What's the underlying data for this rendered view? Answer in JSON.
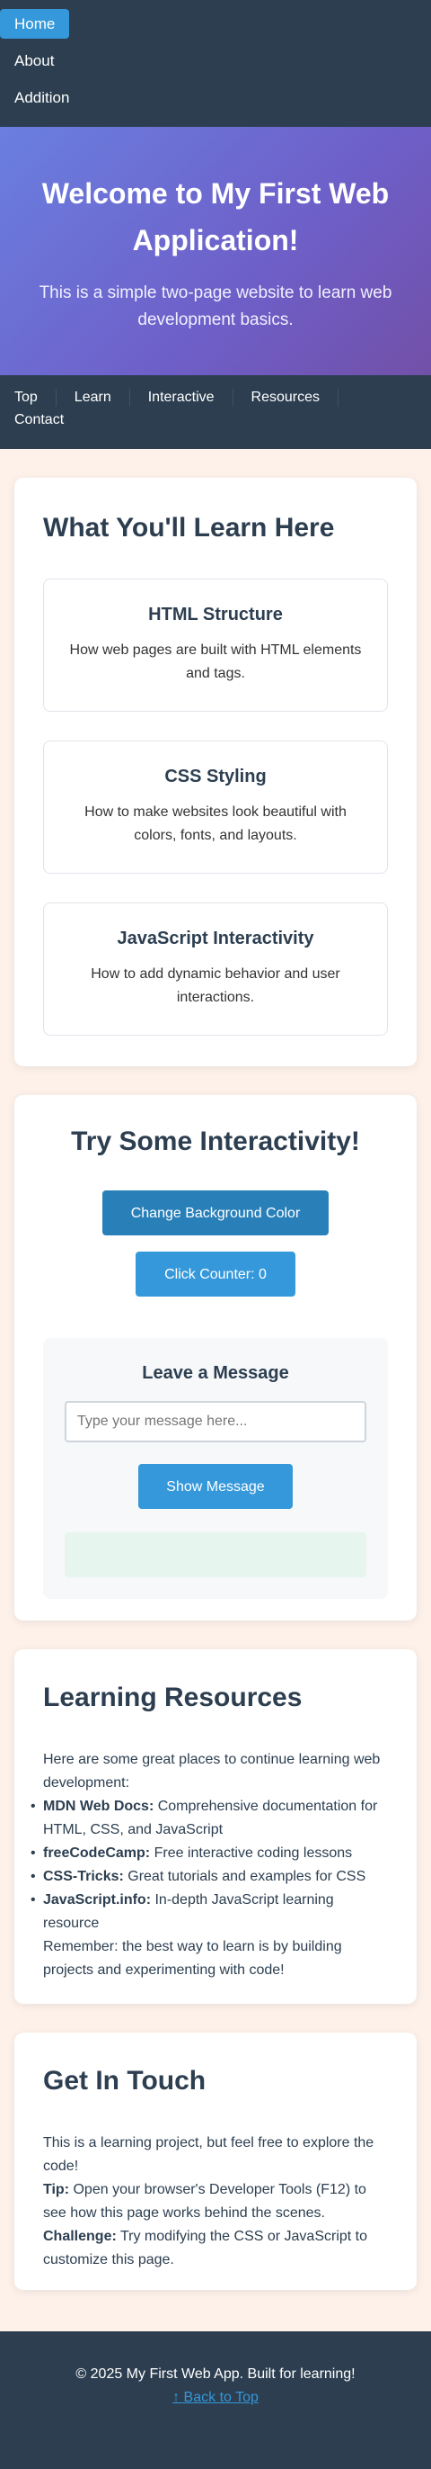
{
  "topnav": {
    "items": [
      "Home",
      "About",
      "Addition"
    ]
  },
  "hero": {
    "title": "Welcome to My First Web Application!",
    "subtitle": "This is a simple two-page website to learn web development basics."
  },
  "secnav": {
    "items": [
      "Top",
      "Learn",
      "Interactive",
      "Resources",
      "Contact"
    ]
  },
  "learn": {
    "heading": "What You'll Learn Here",
    "features": [
      {
        "title": "HTML Structure",
        "text": "How web pages are built with HTML elements and tags."
      },
      {
        "title": "CSS Styling",
        "text": "How to make websites look beautiful with colors, fonts, and layouts."
      },
      {
        "title": "JavaScript Interactivity",
        "text": "How to add dynamic behavior and user interactions."
      }
    ]
  },
  "interactive": {
    "heading": "Try Some Interactivity!",
    "bg_button": "Change Background Color",
    "counter_button": "Click Counter: 0",
    "message_heading": "Leave a Message",
    "message_placeholder": "Type your message here...",
    "message_value": "",
    "show_button": "Show Message",
    "output_text": ""
  },
  "resources": {
    "heading": "Learning Resources",
    "intro": "Here are some great places to continue learning web development:",
    "items": [
      {
        "name": "MDN Web Docs:",
        "desc": " Comprehensive documentation for HTML, CSS, and JavaScript"
      },
      {
        "name": "freeCodeCamp:",
        "desc": " Free interactive coding lessons"
      },
      {
        "name": "CSS-Tricks:",
        "desc": " Great tutorials and examples for CSS"
      },
      {
        "name": "JavaScript.info:",
        "desc": " In-depth JavaScript learning resource"
      }
    ],
    "outro": "Remember: the best way to learn is by building projects and experimenting with code!"
  },
  "contact": {
    "heading": "Get In Touch",
    "intro": "This is a learning project, but feel free to explore the code!",
    "tip_label": "Tip:",
    "tip_text": " Open your browser's Developer Tools (F12) to see how this page works behind the scenes.",
    "challenge_label": "Challenge:",
    "challenge_text": " Try modifying the CSS or JavaScript to customize this page."
  },
  "footer": {
    "copyright": "© 2025 My First Web App. Built for learning!",
    "back_link": "↑ Back to Top"
  },
  "bullet_glyph": "•",
  "colors": {
    "nav_bg": "#2c3e50",
    "accent": "#3498db",
    "accent_dark": "#2980b9",
    "page_bg": "#fdf1ea",
    "hero_gradient_start": "#6a7fe0",
    "hero_gradient_end": "#7250a8"
  }
}
